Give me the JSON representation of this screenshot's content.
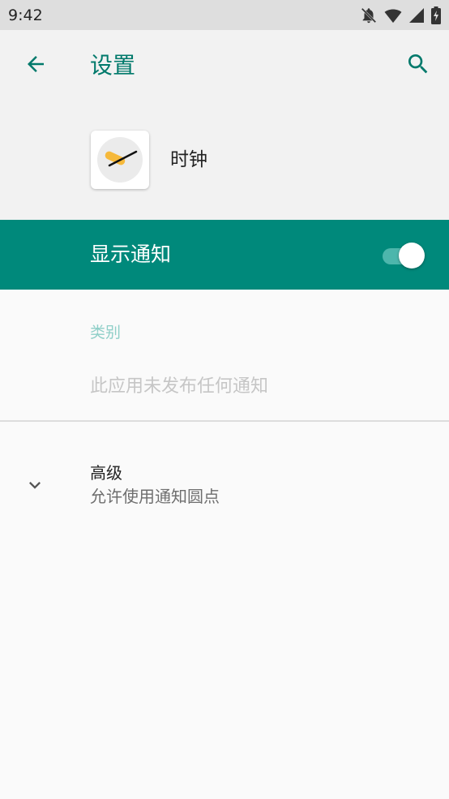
{
  "status_bar": {
    "time": "9:42",
    "icons": [
      "notifications-off-icon",
      "wifi-icon",
      "signal-icon",
      "battery-charging-icon"
    ]
  },
  "app_bar": {
    "title": "设置",
    "back_icon": "arrow-back-icon",
    "search_icon": "search-icon"
  },
  "app_header": {
    "app_name": "时钟",
    "app_icon": "clock-app-icon"
  },
  "master_switch": {
    "label": "显示通知",
    "enabled": true
  },
  "categories": {
    "header": "类别",
    "empty_text": "此应用未发布任何通知"
  },
  "advanced": {
    "title": "高级",
    "summary": "允许使用通知圆点",
    "expand_icon": "chevron-down-icon"
  },
  "colors": {
    "accent": "#00796b",
    "banner": "#00897b",
    "toggle_track": "#4db6ac"
  }
}
